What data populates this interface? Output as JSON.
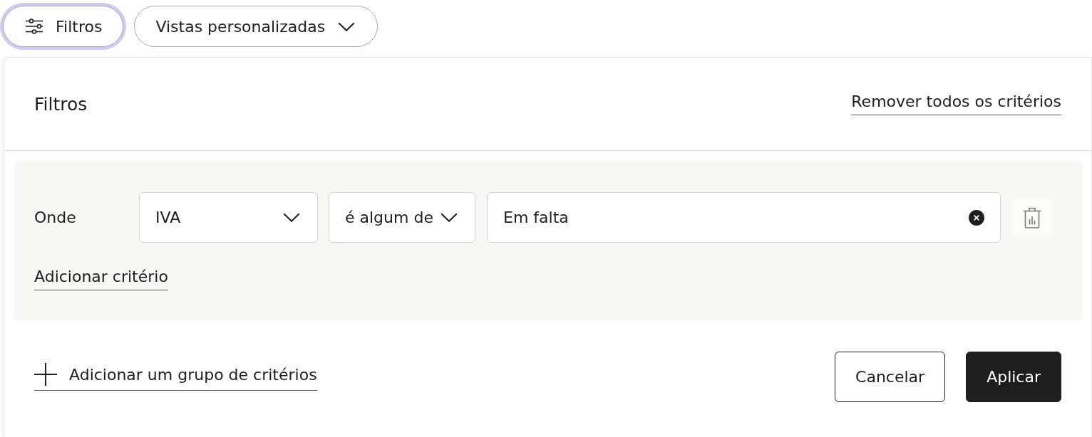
{
  "toolbar": {
    "buttons": [
      {
        "label": "Filtros",
        "kind": "filter",
        "focused": true
      },
      {
        "label": "Vistas personalizadas",
        "kind": "dropdown",
        "focused": false
      }
    ]
  },
  "panel": {
    "title": "Filtros",
    "clear_all_link": "Remover todos os critérios",
    "groups": [
      {
        "criteria": [
          {
            "label": "Onde",
            "field": "IVA",
            "operator": "é algum de",
            "value": "Em falta"
          }
        ],
        "add_criterion_link": "Adicionar critério"
      }
    ],
    "add_group_link": "Adicionar um grupo de critérios",
    "buttons": [
      {
        "label": "Cancelar",
        "kind": "secondary"
      },
      {
        "label": "Aplicar",
        "kind": "primary"
      }
    ]
  }
}
